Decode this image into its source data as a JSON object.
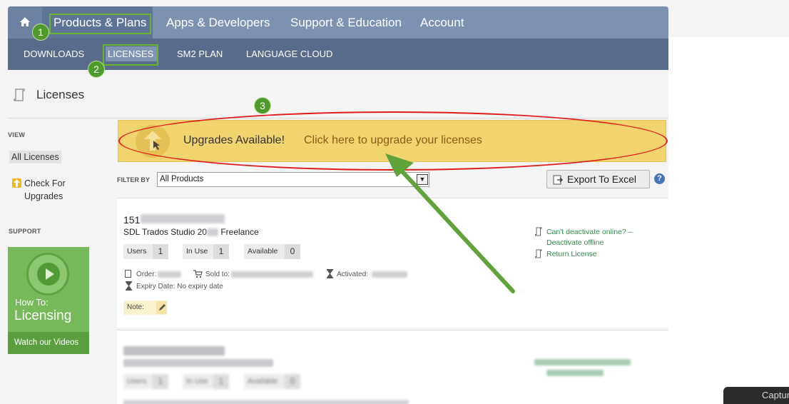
{
  "topnav": {
    "items": [
      "Products & Plans",
      "Apps & Developers",
      "Support & Education",
      "Account"
    ]
  },
  "subnav": {
    "items": [
      "DOWNLOADS",
      "LICENSES",
      "SM2 PLAN",
      "LANGUAGE CLOUD"
    ]
  },
  "callouts": [
    "1",
    "2",
    "3"
  ],
  "page": {
    "title": "Licenses"
  },
  "sidebar": {
    "view_heading": "VIEW",
    "all_licenses": "All Licenses",
    "check_upgrades": "Check For Upgrades",
    "support_heading": "SUPPORT",
    "video": {
      "howto": "How To:",
      "title": "Licensing",
      "footer": "Watch our Videos"
    }
  },
  "banner": {
    "text": "Upgrades Available!",
    "link": "Click here to upgrade your licenses"
  },
  "filter": {
    "label": "FILTER BY",
    "value": "All Products",
    "export_label": "Export To Excel",
    "help": "?"
  },
  "licenses": [
    {
      "number": "151",
      "product": "SDL Trados Studio 20",
      "product_suffix": "Freelance",
      "users_label": "Users",
      "users": "1",
      "inuse_label": "In Use",
      "inuse": "1",
      "available_label": "Available",
      "available": "0",
      "order_label": "Order:",
      "sold_label": "Sold to:",
      "activated_label": "Activated:",
      "expiry": "Expiry Date: No expiry date",
      "note_label": "Note:",
      "deactivate_link": "Can't deactivate online? – Deactivate offline",
      "return_link": "Return License"
    },
    {
      "users_label": "Users",
      "users": "1",
      "inuse_label": "In Use",
      "inuse": "1",
      "available_label": "Available",
      "available": "0"
    }
  ],
  "taskbar": {
    "capture": "Captur"
  }
}
